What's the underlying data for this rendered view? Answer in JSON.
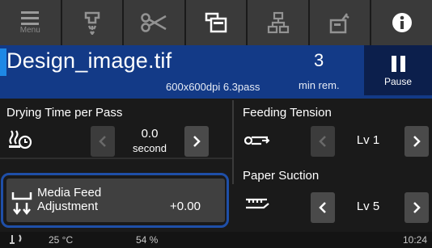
{
  "toolbar": {
    "menu_label": "Menu",
    "buttons": [
      "menu-icon",
      "head-maintenance-icon",
      "cutter-icon",
      "media-settings-icon",
      "network-icon",
      "printer-settings-icon",
      "info-icon"
    ]
  },
  "job": {
    "file_name": "Design_image.tif",
    "details": "600x600dpi 6.3pass",
    "remaining_value": "3",
    "remaining_label": "min rem.",
    "pause_label": "Pause"
  },
  "drying": {
    "title": "Drying Time per Pass",
    "value": "0.0",
    "unit": "second"
  },
  "feeding": {
    "title": "Feeding Tension",
    "value": "Lv 1"
  },
  "suction": {
    "title": "Paper Suction",
    "value": "Lv 5"
  },
  "media_feed": {
    "label_line1": "Media Feed",
    "label_line2": "Adjustment",
    "value": "+0.00"
  },
  "status": {
    "temperature": "25 °C",
    "humidity": "54 %",
    "time": "10:24"
  },
  "colors": {
    "job_bar": "#133a87",
    "accent": "#1e88e5",
    "highlight_outline": "#1f4fa8",
    "pause_button": "#0c1f4c"
  }
}
